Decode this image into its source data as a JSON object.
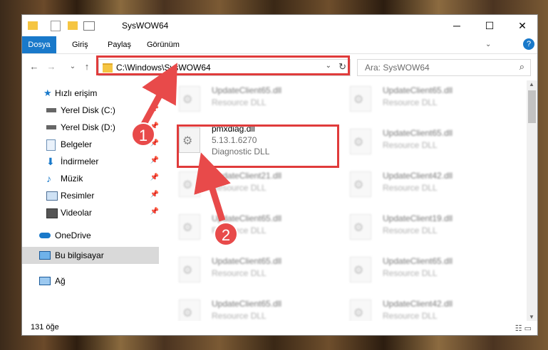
{
  "window": {
    "title": "SysWOW64",
    "controls": {
      "minimize": "─",
      "maximize": "☐",
      "close": "✕"
    }
  },
  "ribbon": {
    "tabs": [
      "Dosya",
      "Giriş",
      "Paylaş",
      "Görünüm"
    ],
    "help": "?"
  },
  "nav": {
    "back": "←",
    "forward": "→",
    "recent": "⌄",
    "up": "↑",
    "address": "C:\\Windows\\SysWOW64",
    "address_dropdown": "⌄",
    "refresh": "↻",
    "search_placeholder": "Ara: SysWOW64",
    "search_icon": "⌕"
  },
  "sidebar": {
    "items": [
      {
        "label": "Hızlı erişim",
        "icon": "star-icon",
        "pin": ""
      },
      {
        "label": "Yerel Disk (C:)",
        "icon": "drive-icon",
        "pin": "📌"
      },
      {
        "label": "Yerel Disk (D:)",
        "icon": "drive-icon",
        "pin": "📌"
      },
      {
        "label": "Belgeler",
        "icon": "documents-icon",
        "pin": "📌"
      },
      {
        "label": "İndirmeler",
        "icon": "download-icon",
        "pin": "📌"
      },
      {
        "label": "Müzik",
        "icon": "music-icon",
        "pin": "📌"
      },
      {
        "label": "Resimler",
        "icon": "pictures-icon",
        "pin": "📌"
      },
      {
        "label": "Videolar",
        "icon": "videos-icon",
        "pin": "📌"
      },
      {
        "label": "OneDrive",
        "icon": "cloud-icon",
        "pin": ""
      },
      {
        "label": "Bu bilgisayar",
        "icon": "computer-icon",
        "pin": ""
      },
      {
        "label": "Ağ",
        "icon": "network-icon",
        "pin": ""
      }
    ]
  },
  "files": {
    "highlighted": {
      "name": "pmxdiag.dll",
      "version": "5.13.1.6270",
      "desc": "Diagnostic DLL"
    },
    "left_column": [
      {
        "name": "UpdateClient65.dll",
        "desc": "Resource DLL"
      },
      {
        "name": "UpdateClient21.dll",
        "desc": "Resource DLL"
      },
      {
        "name": "UpdateClient65.dll",
        "desc": "Resource DLL"
      },
      {
        "name": "UpdateClient65.dll",
        "desc": "Resource DLL"
      },
      {
        "name": "UpdateClient65.dll",
        "desc": "Resource DLL"
      }
    ],
    "right_column": [
      {
        "name": "UpdateClient65.dll",
        "desc": "Resource DLL"
      },
      {
        "name": "UpdateClient65.dll",
        "desc": "Resource DLL"
      },
      {
        "name": "UpdateClient42.dll",
        "desc": "Resource DLL"
      },
      {
        "name": "UpdateClient19.dll",
        "desc": "Resource DLL"
      },
      {
        "name": "UpdateClient65.dll",
        "desc": "Resource DLL"
      },
      {
        "name": "UpdateClient42.dll",
        "desc": "Resource DLL"
      }
    ]
  },
  "status": {
    "count": "131 öğe"
  },
  "annotations": {
    "step1": "1",
    "step2": "2",
    "color": "#e03b3b"
  }
}
